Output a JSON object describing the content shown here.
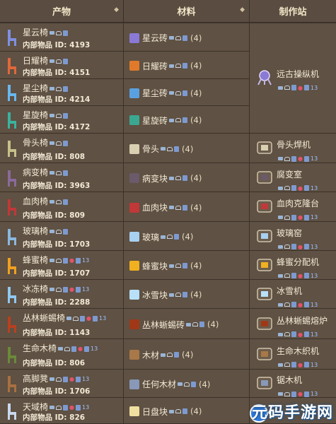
{
  "header": {
    "product": "产物",
    "materials": "材料",
    "station": "制作站",
    "caret": "◆"
  },
  "id_prefix": "内部物品 ID:",
  "rows": [
    {
      "product": "星云椅",
      "id": "4193",
      "material": "星云砖",
      "count": "(4)",
      "chair_color": "#7f8fe0",
      "mat_color": "#8a7ad6"
    },
    {
      "product": "日耀椅",
      "id": "4151",
      "material": "日耀砖",
      "count": "(4)",
      "chair_color": "#e0683a",
      "mat_color": "#e07a2a"
    },
    {
      "product": "星尘椅",
      "id": "4214",
      "material": "星尘砖",
      "count": "(4)",
      "chair_color": "#68b8f0",
      "mat_color": "#5aa0e0"
    },
    {
      "product": "星旋椅",
      "id": "4172",
      "material": "星旋砖",
      "count": "(4)",
      "chair_color": "#3ab3a0",
      "mat_color": "#3aa890"
    },
    {
      "product": "骨头椅",
      "id": "808",
      "material": "骨头",
      "count": "(4)",
      "chair_color": "#c8c08a",
      "mat_color": "#d8d0b0",
      "station": "骨头焊机"
    },
    {
      "product": "病变椅",
      "id": "3963",
      "material": "病变块",
      "count": "(4)",
      "chair_color": "#8a6a9a",
      "mat_color": "#6a5a6a",
      "station": "腐变室"
    },
    {
      "product": "血肉椅",
      "id": "809",
      "material": "血肉块",
      "count": "(4)",
      "chair_color": "#c03838",
      "mat_color": "#c03838",
      "station": "血肉克隆台"
    },
    {
      "product": "玻璃椅",
      "id": "1703",
      "material": "玻璃",
      "count": "(4)",
      "chair_color": "#8ab8e0",
      "mat_color": "#a8d0f0",
      "station": "玻璃窑"
    },
    {
      "product": "蜂蜜椅",
      "id": "1707",
      "material": "蜂蜜块",
      "count": "(4)",
      "chair_color": "#f0a020",
      "mat_color": "#f0b020",
      "station": "蜂蜜分配机"
    },
    {
      "product": "冰冻椅",
      "id": "2288",
      "material": "冰雪块",
      "count": "(4)",
      "chair_color": "#90c8f0",
      "mat_color": "#b8e0f8",
      "station": "冰雪机"
    },
    {
      "product": "丛林蜥蜴椅",
      "id": "1143",
      "material": "丛林蜥蜴砖",
      "count": "(4)",
      "chair_color": "#b84020",
      "mat_color": "#a03818",
      "station": "丛林蜥蜴熔炉"
    },
    {
      "product": "生命木椅",
      "id": "806",
      "material": "木材",
      "count": "(4)",
      "chair_color": "#6a8a3a",
      "mat_color": "#a87848",
      "station": "生命木织机"
    },
    {
      "product": "高脚凳",
      "id": "1706",
      "material": "任何木材",
      "count": "(4)",
      "chair_color": "#a87040",
      "mat_color": "#8898b8",
      "station": "锯木机"
    },
    {
      "product": "天域椅",
      "id": "826",
      "material": "日盘块",
      "count": "(4)",
      "chair_color": "#c8d8f0",
      "mat_color": "#f0e0a0"
    }
  ],
  "merged_station": {
    "name": "远古操纵机"
  },
  "watermark": "元码手游网"
}
